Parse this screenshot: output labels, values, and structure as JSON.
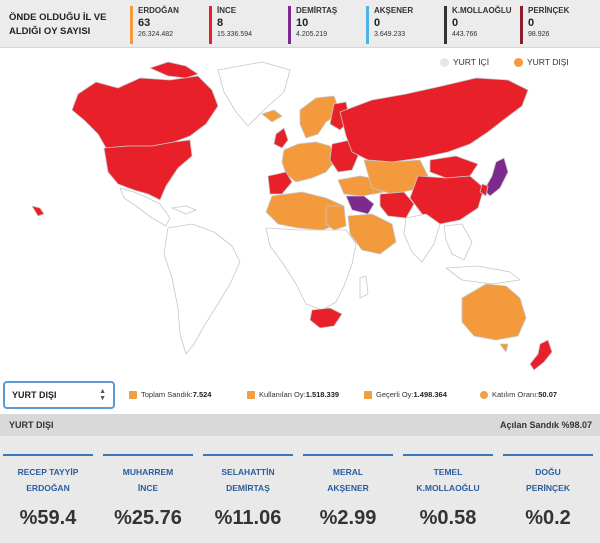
{
  "header": {
    "title": "ÖNDE OLDUĞU İL VE ALDIĞI OY SAYISI",
    "candidates": [
      {
        "name": "ERDOĞAN",
        "seats": "63",
        "votes": "26.324.482",
        "color": "#f39a3c"
      },
      {
        "name": "İNCE",
        "seats": "8",
        "votes": "15.336.594",
        "color": "#e8202a"
      },
      {
        "name": "DEMİRTAŞ",
        "seats": "10",
        "votes": "4.205.219",
        "color": "#7d2a8e"
      },
      {
        "name": "AKŞENER",
        "seats": "0",
        "votes": "3.649.233",
        "color": "#4bb3e6"
      },
      {
        "name": "K.MOLLAOĞLU",
        "seats": "0",
        "votes": "443.766",
        "color": "#333333"
      },
      {
        "name": "PERİNÇEK",
        "seats": "0",
        "votes": "98.926",
        "color": "#8b1c2c"
      }
    ]
  },
  "legend": {
    "domestic": {
      "label": "YURT İÇİ",
      "color": "#e6e6e6"
    },
    "abroad": {
      "label": "YURT DIŞI",
      "color": "#f39a3c"
    }
  },
  "map_colors": {
    "red": "#e8202a",
    "orange": "#f39a3c",
    "purple": "#7d2a8e",
    "land": "#ffffff",
    "border": "#c8c8c8"
  },
  "filter": {
    "selected": "YURT DIŞI"
  },
  "stats": {
    "total_box_label": "Toplam Sandık:",
    "total_box": "7.524",
    "used_votes_label": "Kullanılan Oy:",
    "used_votes": "1.518.339",
    "valid_votes_label": "Geçerli Oy:",
    "valid_votes": "1.498.364",
    "turnout_label": "Katılım Oranı:",
    "turnout": "50.07"
  },
  "results": {
    "region": "YURT DIŞI",
    "opened": "Açılan Sandık %98.07",
    "items": [
      {
        "line1": "RECEP TAYYİP",
        "line2": "ERDOĞAN",
        "pct": "%59.4"
      },
      {
        "line1": "MUHARREM",
        "line2": "İNCE",
        "pct": "%25.76"
      },
      {
        "line1": "SELAHATTİN",
        "line2": "DEMİRTAŞ",
        "pct": "%11.06"
      },
      {
        "line1": "MERAL",
        "line2": "AKŞENER",
        "pct": "%2.99"
      },
      {
        "line1": "TEMEL",
        "line2": "K.MOLLAOĞLU",
        "pct": "%0.58"
      },
      {
        "line1": "DOĞU",
        "line2": "PERİNÇEK",
        "pct": "%0.2"
      }
    ]
  }
}
